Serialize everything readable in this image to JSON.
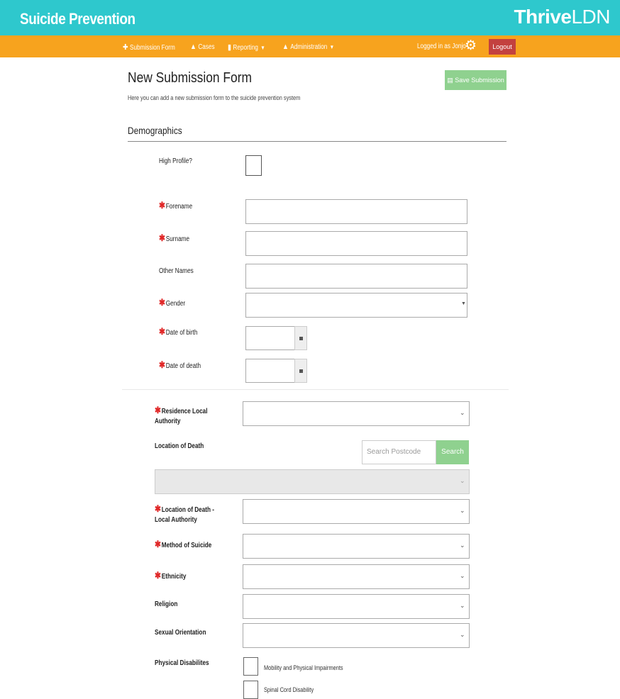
{
  "header": {
    "app_title": "Suicide Prevention",
    "brand_bold": "Thrive",
    "brand_light": "LDN"
  },
  "nav": {
    "items": [
      {
        "label": "Submission Form",
        "icon": "plus-circle-icon",
        "dropdown": false
      },
      {
        "label": "Cases",
        "icon": "home-icon",
        "dropdown": false
      },
      {
        "label": "Reporting",
        "icon": "bar-chart-icon",
        "dropdown": true
      },
      {
        "label": "Administration",
        "icon": "home-icon",
        "dropdown": true
      }
    ],
    "logged_in_text": "Logged in as Jonjo",
    "settings_icon": "cogs-icon",
    "logout_label": "Logout"
  },
  "colors": {
    "header": "#2ec8cd",
    "nav": "#f7a31e",
    "logout": "#c3413f",
    "save": "#8fd18f",
    "required": "#e02828"
  },
  "page": {
    "title": "New Submission Form",
    "subtitle": "Here you can add a new submission form to the suicide prevention system",
    "save_label": "Save Submission"
  },
  "demographics": {
    "section_title": "Demographics",
    "high_profile_label": "High Profile?",
    "forename_label": "Forename",
    "surname_label": "Surname",
    "other_names_label": "Other Names",
    "gender_label": "Gender",
    "dob_label": "Date of birth",
    "dod_label": "Date of death"
  },
  "location": {
    "residence_la_line1": "Residence Local",
    "residence_la_line2": "Authority",
    "location_of_death_label": "Location of Death",
    "search_placeholder": "Search Postcode",
    "search_label": "Search",
    "lod_la_line1": "Location of Death -",
    "lod_la_line2": "Local Authority",
    "method_label": "Method of Suicide",
    "ethnicity_label": "Ethnicity",
    "religion_label": "Religion",
    "sexual_orientation_label": "Sexual Orientation",
    "physical_disabilities_label": "Physical Disabilites",
    "disability_options": [
      "Mobility and Physical Impairments",
      "Spinal Cord Disability"
    ]
  }
}
